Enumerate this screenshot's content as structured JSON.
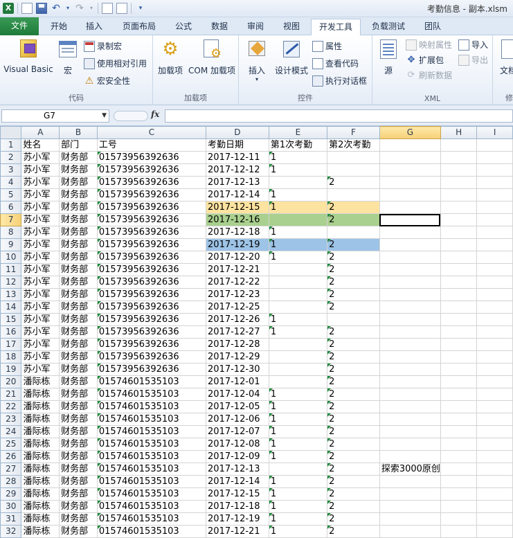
{
  "window": {
    "title": "考勤信息 - 副本.xlsm"
  },
  "tabs": [
    {
      "label": "文件"
    },
    {
      "label": "开始"
    },
    {
      "label": "插入"
    },
    {
      "label": "页面布局"
    },
    {
      "label": "公式"
    },
    {
      "label": "数据"
    },
    {
      "label": "审阅"
    },
    {
      "label": "视图"
    },
    {
      "label": "开发工具"
    },
    {
      "label": "负载测试"
    },
    {
      "label": "团队"
    }
  ],
  "ribbon": {
    "code": {
      "label": "代码",
      "visual_basic": "Visual Basic",
      "macros": "宏",
      "record_macro": "录制宏",
      "relative_ref": "使用相对引用",
      "macro_security": "宏安全性"
    },
    "addins": {
      "label": "加载项",
      "addins": "加载项",
      "com_addins": "COM 加载项"
    },
    "controls": {
      "label": "控件",
      "insert": "插入",
      "design_mode": "设计模式",
      "properties": "属性",
      "view_code": "查看代码",
      "run_dialog": "执行对话框"
    },
    "xml": {
      "label": "XML",
      "source": "源",
      "map_props": "映射属性",
      "expansion": "扩展包",
      "refresh": "刷新数据",
      "import": "导入",
      "export": "导出"
    },
    "modify": {
      "doc": "文档",
      "label": "修"
    }
  },
  "formula_bar": {
    "name_box": "G7",
    "fx": "fx",
    "formula": ""
  },
  "sheet": {
    "columns": [
      "A",
      "B",
      "C",
      "D",
      "E",
      "F",
      "G",
      "H",
      "I"
    ],
    "selected_column": "G",
    "selected_row": 7,
    "rows": [
      {
        "n": 1,
        "cells": [
          "姓名",
          "部门",
          "工号",
          "考勤日期",
          "第1次考勤",
          "第2次考勤",
          "",
          "",
          ""
        ]
      },
      {
        "n": 2,
        "cells": [
          "苏小军",
          "财务部",
          "01573956392636",
          "2017-12-11",
          "1",
          "",
          "",
          "",
          ""
        ]
      },
      {
        "n": 3,
        "cells": [
          "苏小军",
          "财务部",
          "01573956392636",
          "2017-12-12",
          "1",
          "",
          "",
          "",
          ""
        ]
      },
      {
        "n": 4,
        "cells": [
          "苏小军",
          "财务部",
          "01573956392636",
          "2017-12-13",
          "",
          "2",
          "",
          "",
          ""
        ]
      },
      {
        "n": 5,
        "cells": [
          "苏小军",
          "财务部",
          "01573956392636",
          "2017-12-14",
          "1",
          "",
          "",
          "",
          ""
        ]
      },
      {
        "n": 6,
        "cells": [
          "苏小军",
          "财务部",
          "01573956392636",
          "2017-12-15",
          "1",
          "2",
          "",
          "",
          ""
        ]
      },
      {
        "n": 7,
        "cells": [
          "苏小军",
          "财务部",
          "01573956392636",
          "2017-12-16",
          "",
          "2",
          "",
          "",
          ""
        ]
      },
      {
        "n": 8,
        "cells": [
          "苏小军",
          "财务部",
          "01573956392636",
          "2017-12-18",
          "1",
          "",
          "",
          "",
          ""
        ]
      },
      {
        "n": 9,
        "cells": [
          "苏小军",
          "财务部",
          "01573956392636",
          "2017-12-19",
          "1",
          "2",
          "",
          "",
          ""
        ]
      },
      {
        "n": 10,
        "cells": [
          "苏小军",
          "财务部",
          "01573956392636",
          "2017-12-20",
          "1",
          "2",
          "",
          "",
          ""
        ]
      },
      {
        "n": 11,
        "cells": [
          "苏小军",
          "财务部",
          "01573956392636",
          "2017-12-21",
          "",
          "2",
          "",
          "",
          ""
        ]
      },
      {
        "n": 12,
        "cells": [
          "苏小军",
          "财务部",
          "01573956392636",
          "2017-12-22",
          "",
          "2",
          "",
          "",
          ""
        ]
      },
      {
        "n": 13,
        "cells": [
          "苏小军",
          "财务部",
          "01573956392636",
          "2017-12-23",
          "",
          "2",
          "",
          "",
          ""
        ]
      },
      {
        "n": 14,
        "cells": [
          "苏小军",
          "财务部",
          "01573956392636",
          "2017-12-25",
          "",
          "2",
          "",
          "",
          ""
        ]
      },
      {
        "n": 15,
        "cells": [
          "苏小军",
          "财务部",
          "01573956392636",
          "2017-12-26",
          "1",
          "",
          "",
          "",
          ""
        ]
      },
      {
        "n": 16,
        "cells": [
          "苏小军",
          "财务部",
          "01573956392636",
          "2017-12-27",
          "1",
          "2",
          "",
          "",
          ""
        ]
      },
      {
        "n": 17,
        "cells": [
          "苏小军",
          "财务部",
          "01573956392636",
          "2017-12-28",
          "",
          "2",
          "",
          "",
          ""
        ]
      },
      {
        "n": 18,
        "cells": [
          "苏小军",
          "财务部",
          "01573956392636",
          "2017-12-29",
          "",
          "2",
          "",
          "",
          ""
        ]
      },
      {
        "n": 19,
        "cells": [
          "苏小军",
          "财务部",
          "01573956392636",
          "2017-12-30",
          "",
          "2",
          "",
          "",
          ""
        ]
      },
      {
        "n": 20,
        "cells": [
          "潘际栋",
          "财务部",
          "01574601535103",
          "2017-12-01",
          "",
          "2",
          "",
          "",
          ""
        ]
      },
      {
        "n": 21,
        "cells": [
          "潘际栋",
          "财务部",
          "01574601535103",
          "2017-12-04",
          "1",
          "2",
          "",
          "",
          ""
        ]
      },
      {
        "n": 22,
        "cells": [
          "潘际栋",
          "财务部",
          "01574601535103",
          "2017-12-05",
          "1",
          "2",
          "",
          "",
          ""
        ]
      },
      {
        "n": 23,
        "cells": [
          "潘际栋",
          "财务部",
          "01574601535103",
          "2017-12-06",
          "1",
          "2",
          "",
          "",
          ""
        ]
      },
      {
        "n": 24,
        "cells": [
          "潘际栋",
          "财务部",
          "01574601535103",
          "2017-12-07",
          "1",
          "2",
          "",
          "",
          ""
        ]
      },
      {
        "n": 25,
        "cells": [
          "潘际栋",
          "财务部",
          "01574601535103",
          "2017-12-08",
          "1",
          "2",
          "",
          "",
          ""
        ]
      },
      {
        "n": 26,
        "cells": [
          "潘际栋",
          "财务部",
          "01574601535103",
          "2017-12-09",
          "1",
          "2",
          "",
          "",
          ""
        ]
      },
      {
        "n": 27,
        "cells": [
          "潘际栋",
          "财务部",
          "01574601535103",
          "2017-12-13",
          "",
          "2",
          "探索3000原创",
          "",
          ""
        ]
      },
      {
        "n": 28,
        "cells": [
          "潘际栋",
          "财务部",
          "01574601535103",
          "2017-12-14",
          "1",
          "2",
          "",
          "",
          ""
        ]
      },
      {
        "n": 29,
        "cells": [
          "潘际栋",
          "财务部",
          "01574601535103",
          "2017-12-15",
          "1",
          "2",
          "",
          "",
          ""
        ]
      },
      {
        "n": 30,
        "cells": [
          "潘际栋",
          "财务部",
          "01574601535103",
          "2017-12-18",
          "1",
          "2",
          "",
          "",
          ""
        ]
      },
      {
        "n": 31,
        "cells": [
          "潘际栋",
          "财务部",
          "01574601535103",
          "2017-12-19",
          "1",
          "2",
          "",
          "",
          ""
        ]
      },
      {
        "n": 32,
        "cells": [
          "潘际栋",
          "财务部",
          "01574601535103",
          "2017-12-21",
          "1",
          "2",
          "",
          "",
          ""
        ]
      }
    ],
    "highlights": {
      "6": "yellow",
      "7": "green",
      "9": "blue"
    },
    "colors": {
      "yellow": "#fde3a0",
      "green": "#a9d08e",
      "blue": "#9dc3e6",
      "error_triangle": "#1c8a3a"
    }
  }
}
